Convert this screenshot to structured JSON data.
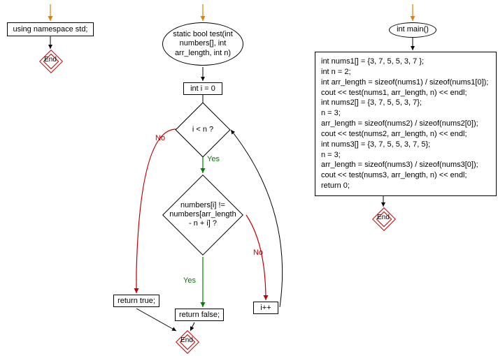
{
  "flowchart": {
    "col1": {
      "entry_arrow": true,
      "node1": "using namespace std;",
      "end": "End"
    },
    "col2": {
      "entry_arrow": true,
      "func_decl": "static bool test(int\nnumbers[], int\narr_length, int n)",
      "init": "int i = 0",
      "cond1": "i < n ?",
      "cond2": "numbers[i] !=\nnumbers[arr_length\n- n + i] ?",
      "ret_true": "return true;",
      "ret_false": "return false;",
      "incr": "i++",
      "end": "End",
      "labels": {
        "yes": "Yes",
        "no": "No"
      }
    },
    "col3": {
      "entry_arrow": true,
      "main_decl": "int main()",
      "code": "int nums1[] = {3, 7, 5, 5, 3, 7 };\nint n = 2;\nint arr_length = sizeof(nums1) / sizeof(nums1[0]);\ncout << test(nums1, arr_length, n) << endl;\nint nums2[] = {3, 7, 5, 5, 3, 7};\nn = 3;\narr_length = sizeof(nums2) / sizeof(nums2[0]);\ncout << test(nums2, arr_length, n) << endl;\nint nums3[] = {3, 7, 5, 5, 3, 7, 5};\nn = 3;\narr_length = sizeof(nums3) / sizeof(nums3[0]);\ncout << test(nums3, arr_length, n) << endl;\nreturn 0;",
      "end": "End"
    }
  }
}
